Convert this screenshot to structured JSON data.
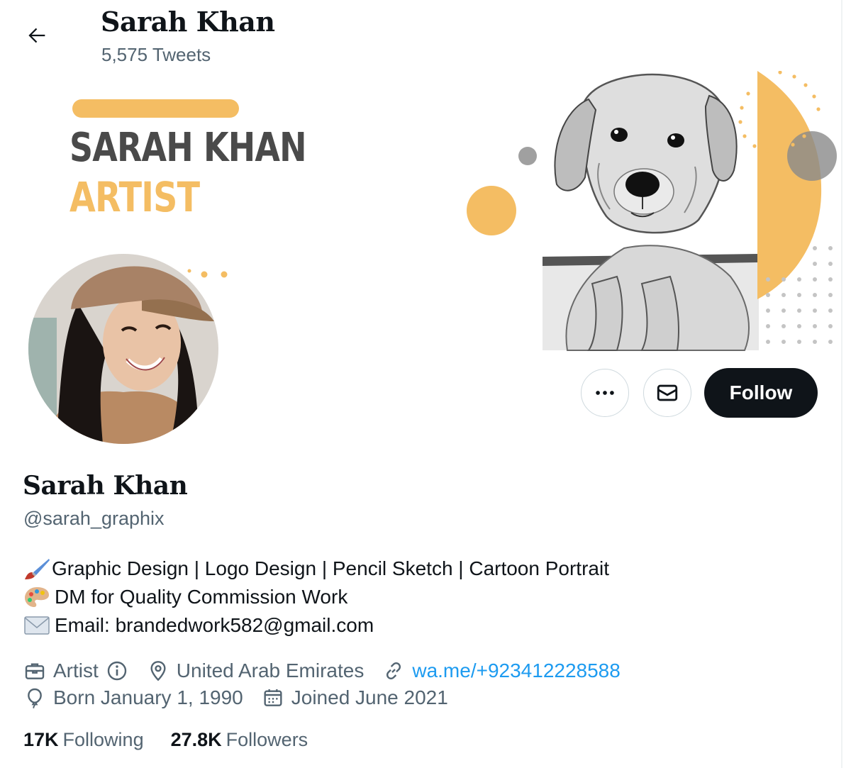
{
  "header": {
    "name": "Sarah Khan",
    "tweet_count": "5,575 Tweets"
  },
  "banner": {
    "title": "SARAH KHAN",
    "subtitle": "ARTIST",
    "accent_color": "#f4bd63",
    "text_color": "#4a4a4a",
    "gray_dot_color": "#a0a0a0"
  },
  "actions": {
    "follow_label": "Follow"
  },
  "profile": {
    "name": "Sarah Khan",
    "handle": "@sarah_graphix",
    "bio": [
      {
        "icon": "paintbrush-emoji",
        "text": "Graphic Design | Logo Design | Pencil Sketch | Cartoon Portrait"
      },
      {
        "icon": "artist-palette-emoji",
        "text": " DM for Quality Commission Work"
      },
      {
        "icon": "envelope-emoji",
        "text": " Email: brandedwork582@gmail.com"
      }
    ],
    "category": "Artist",
    "location": "United Arab Emirates",
    "website": "wa.me/+923412228588",
    "born": "Born January 1, 1990",
    "joined": "Joined June 2021"
  },
  "stats": {
    "following_count": "17K",
    "following_label": "Following",
    "followers_count": "27.8K",
    "followers_label": "Followers"
  },
  "colors": {
    "text_primary": "#0f1419",
    "text_secondary": "#536471",
    "link": "#1d9bf0",
    "button_dark": "#0f1419",
    "border": "#cfd9de"
  }
}
